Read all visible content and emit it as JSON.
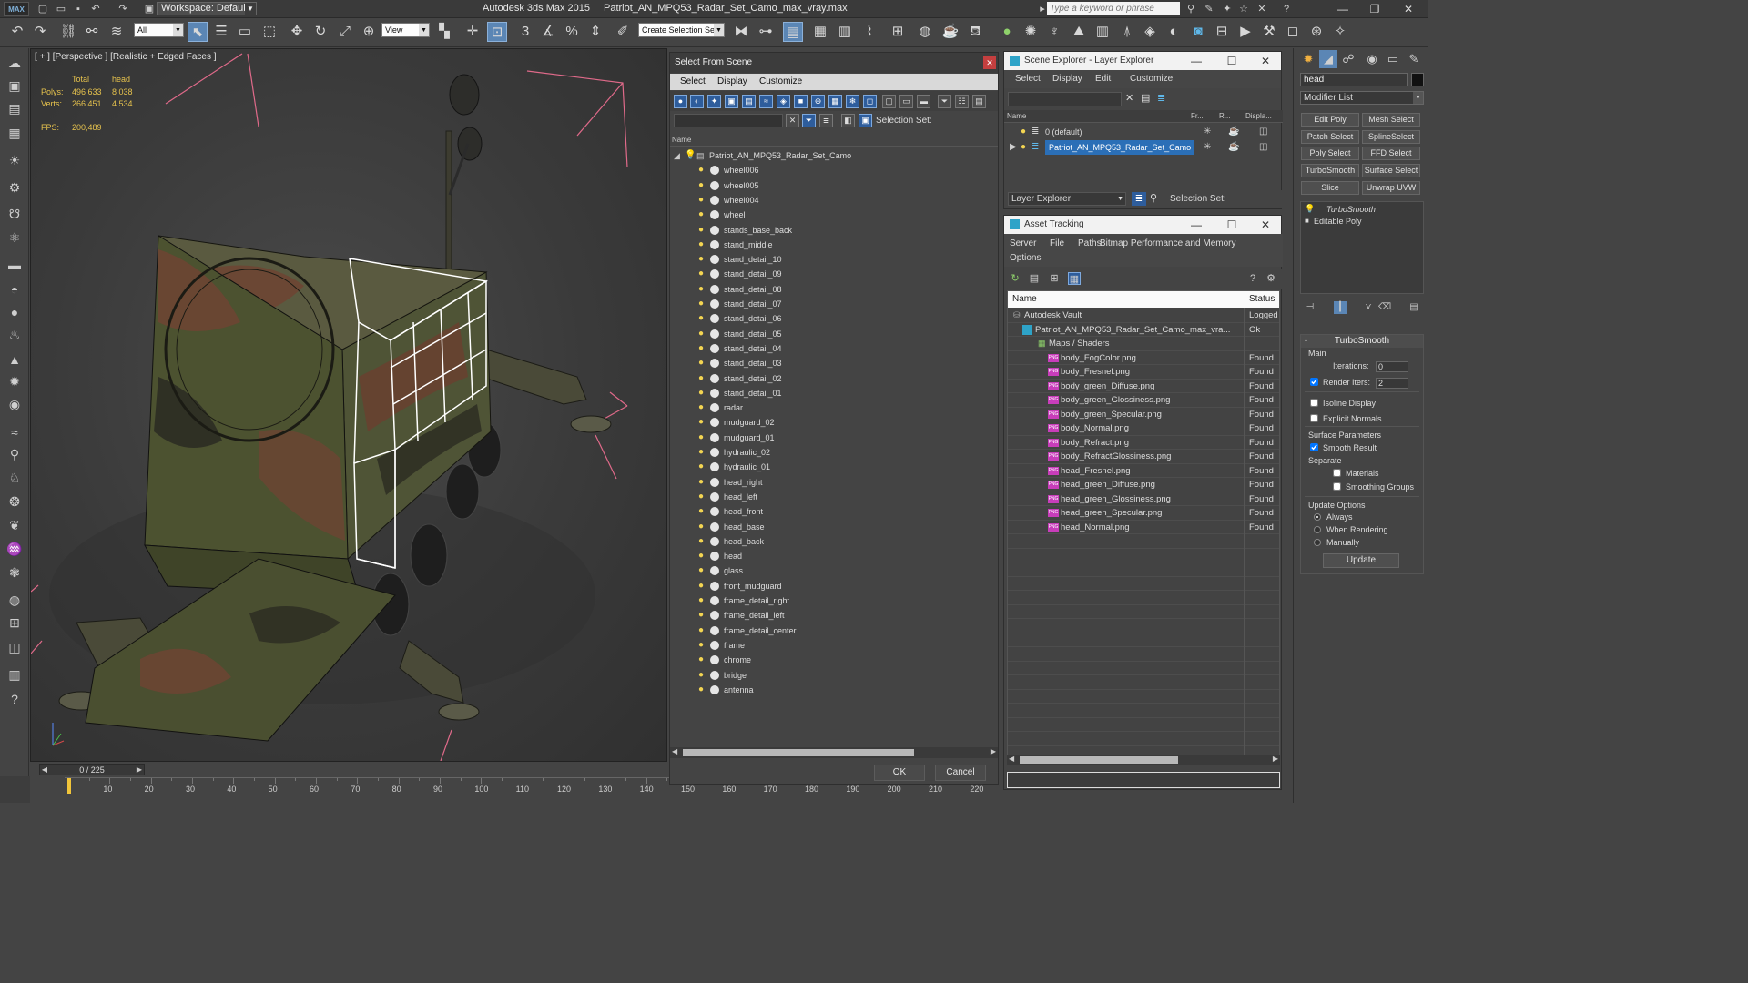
{
  "app": {
    "logo": "MAX",
    "workspace": "Workspace: Default",
    "title": "Autodesk 3ds Max  2015",
    "file": "Patriot_AN_MPQ53_Radar_Set_Camo_max_vray.max",
    "search_placeholder": "Type a keyword or phrase"
  },
  "toolbar": {
    "filter_value": "All",
    "refcoord_value": "View",
    "named_selection_placeholder": "Create Selection Se"
  },
  "viewport": {
    "label": "[ + ] [Perspective ] [Realistic + Edged Faces ]",
    "stats": {
      "col_total": "Total",
      "col_head": "head",
      "polys_label": "Polys:",
      "polys_total": "496 633",
      "polys_head": "8 038",
      "verts_label": "Verts:",
      "verts_total": "266 451",
      "verts_head": "4 534",
      "fps_label": "FPS:",
      "fps_value": "200,489"
    }
  },
  "timeline": {
    "frame": "0 / 225",
    "ticks": [
      "10",
      "20",
      "30",
      "40",
      "50",
      "60",
      "70",
      "80",
      "90",
      "100",
      "110",
      "120",
      "130",
      "140",
      "150",
      "160",
      "170",
      "180",
      "190",
      "200",
      "210",
      "220"
    ]
  },
  "select_from_scene": {
    "title": "Select From Scene",
    "menu": [
      "Select",
      "Display",
      "Customize"
    ],
    "selection_set_label": "Selection Set:",
    "column_name": "Name",
    "root": "Patriot_AN_MPQ53_Radar_Set_Camo",
    "objects": [
      "wheel006",
      "wheel005",
      "wheel004",
      "wheel",
      "stands_base_back",
      "stand_middle",
      "stand_detail_10",
      "stand_detail_09",
      "stand_detail_08",
      "stand_detail_07",
      "stand_detail_06",
      "stand_detail_05",
      "stand_detail_04",
      "stand_detail_03",
      "stand_detail_02",
      "stand_detail_01",
      "radar",
      "mudguard_02",
      "mudguard_01",
      "hydraulic_02",
      "hydraulic_01",
      "head_right",
      "head_left",
      "head_front",
      "head_base",
      "head_back",
      "head",
      "glass",
      "front_mudguard",
      "frame_detail_right",
      "frame_detail_left",
      "frame_detail_center",
      "frame",
      "chrome",
      "bridge",
      "antenna"
    ],
    "ok_label": "OK",
    "cancel_label": "Cancel"
  },
  "scene_explorer": {
    "title": "Scene Explorer - Layer Explorer",
    "menu": [
      "Select",
      "Display",
      "Edit",
      "Customize"
    ],
    "columns": [
      "Name",
      "Fr...",
      "R...",
      "Displa..."
    ],
    "layers": [
      "0 (default)",
      "Patriot_AN_MPQ53_Radar_Set_Camo"
    ],
    "footer_dropdown": "Layer Explorer",
    "selection_set_label": "Selection Set:"
  },
  "asset_tracking": {
    "title": "Asset Tracking",
    "menu": [
      "Server",
      "File",
      "Paths",
      "Bitmap Performance and Memory",
      "Options"
    ],
    "col_name": "Name",
    "col_status": "Status",
    "rows": [
      {
        "name": "Autodesk Vault",
        "status": "Logged",
        "indent": 0
      },
      {
        "name": "Patriot_AN_MPQ53_Radar_Set_Camo_max_vra...",
        "status": "Ok",
        "indent": 1
      },
      {
        "name": "Maps / Shaders",
        "status": "",
        "indent": 2
      },
      {
        "name": "body_FogColor.png",
        "status": "Found",
        "indent": 3
      },
      {
        "name": "body_Fresnel.png",
        "status": "Found",
        "indent": 3
      },
      {
        "name": "body_green_Diffuse.png",
        "status": "Found",
        "indent": 3
      },
      {
        "name": "body_green_Glossiness.png",
        "status": "Found",
        "indent": 3
      },
      {
        "name": "body_green_Specular.png",
        "status": "Found",
        "indent": 3
      },
      {
        "name": "body_Normal.png",
        "status": "Found",
        "indent": 3
      },
      {
        "name": "body_Refract.png",
        "status": "Found",
        "indent": 3
      },
      {
        "name": "body_RefractGlossiness.png",
        "status": "Found",
        "indent": 3
      },
      {
        "name": "head_Fresnel.png",
        "status": "Found",
        "indent": 3
      },
      {
        "name": "head_green_Diffuse.png",
        "status": "Found",
        "indent": 3
      },
      {
        "name": "head_green_Glossiness.png",
        "status": "Found",
        "indent": 3
      },
      {
        "name": "head_green_Specular.png",
        "status": "Found",
        "indent": 3
      },
      {
        "name": "head_Normal.png",
        "status": "Found",
        "indent": 3
      }
    ],
    "png_badge": "PNG"
  },
  "command_panel": {
    "object_name": "head",
    "modifier_list": "Modifier List",
    "buttons": [
      "Edit Poly",
      "Mesh Select",
      "Patch Select",
      "SplineSelect",
      "Poly Select",
      "FFD Select",
      "TurboSmooth",
      "Surface Select",
      "Slice",
      "Unwrap UVW"
    ],
    "stack": [
      "TurboSmooth",
      "Editable Poly"
    ],
    "turbosmooth": {
      "title": "TurboSmooth",
      "main": "Main",
      "iterations_label": "Iterations:",
      "iterations_value": "0",
      "render_iters_label": "Render Iters:",
      "render_iters_value": "2",
      "isoline": "Isoline Display",
      "explicit": "Explicit Normals",
      "surface_params": "Surface Parameters",
      "smooth_result": "Smooth Result",
      "separate": "Separate",
      "materials": "Materials",
      "smoothing_groups": "Smoothing Groups",
      "update_options": "Update Options",
      "always": "Always",
      "when_rendering": "When Rendering",
      "manually": "Manually",
      "update_button": "Update"
    }
  }
}
